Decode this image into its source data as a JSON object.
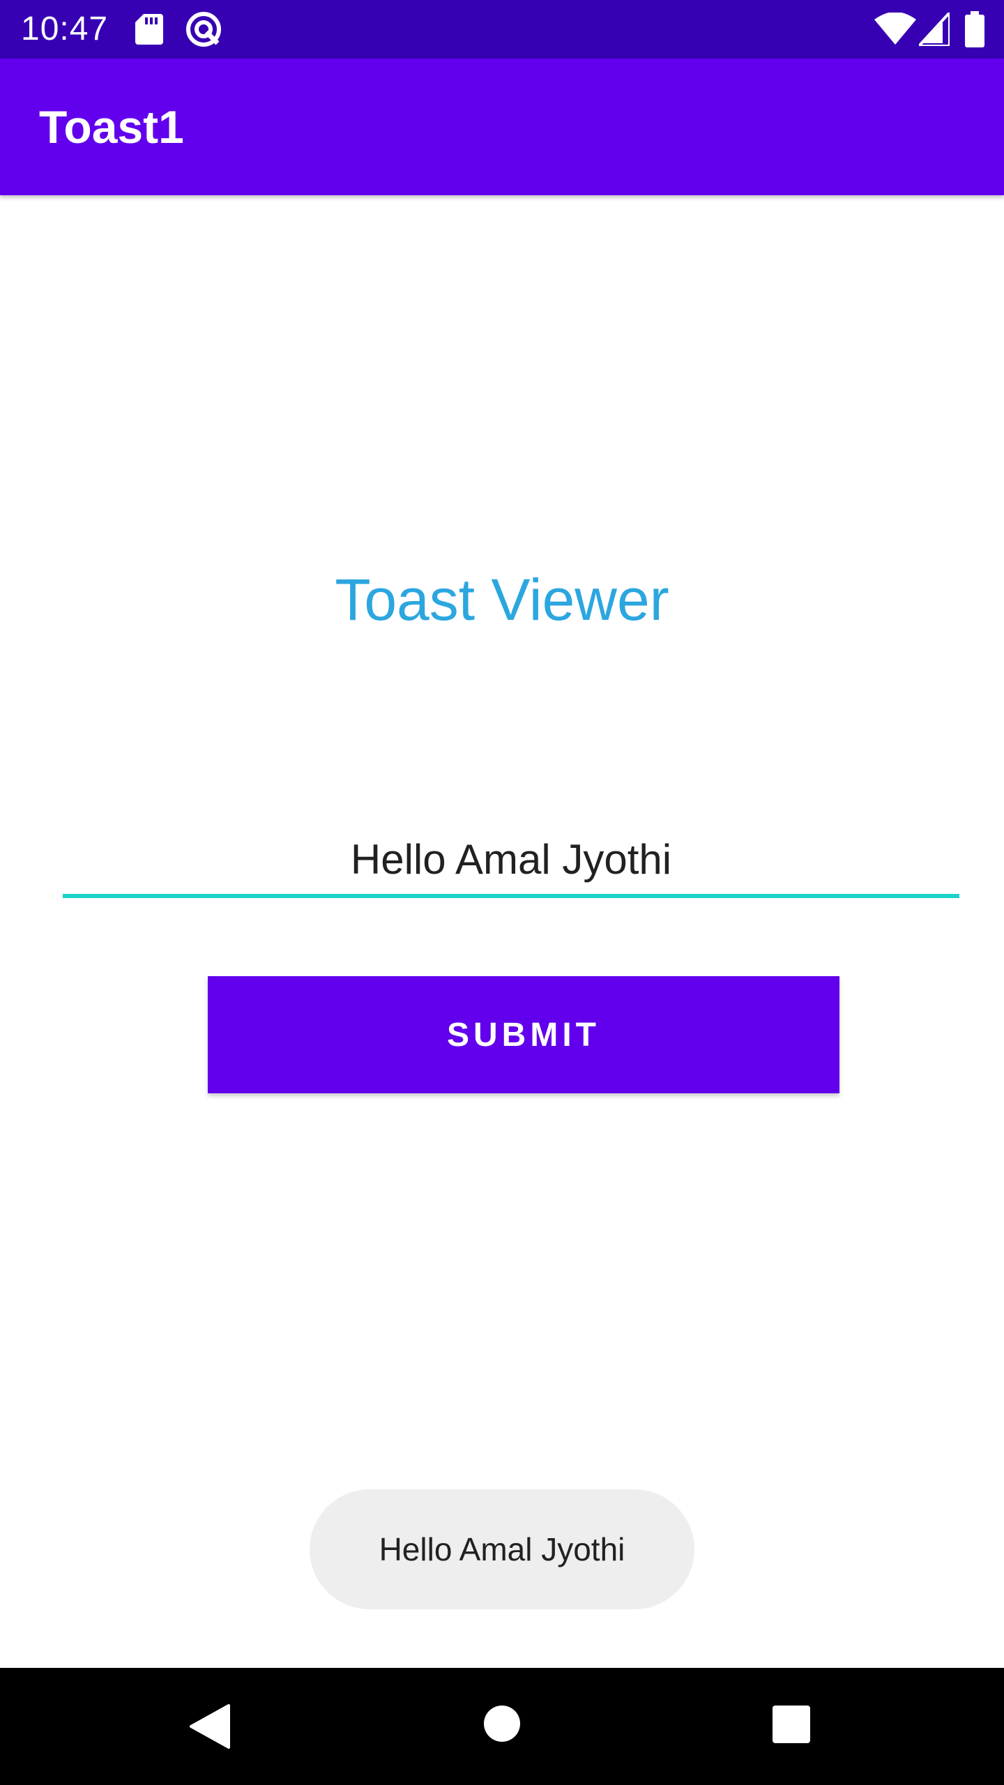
{
  "status_bar": {
    "time": "10:47",
    "background": "#3700B3",
    "icons": [
      "sd-card-icon",
      "sync-icon",
      "wifi-icon",
      "cell-signal-icon",
      "battery-icon"
    ]
  },
  "app_bar": {
    "title": "Toast1",
    "background": "#6200EE"
  },
  "main": {
    "heading": "Toast Viewer",
    "heading_color": "#2CA6DF",
    "input": {
      "value": "Hello Amal Jyothi",
      "underline_color": "#1BD3C6"
    },
    "submit_label": "SUBMIT",
    "button_color": "#6200EE"
  },
  "toast": {
    "message": "Hello Amal Jyothi",
    "background": "#EEEEEE"
  },
  "nav_bar": {
    "background": "#000000",
    "icons": [
      "back-icon",
      "home-icon",
      "recents-icon"
    ]
  }
}
